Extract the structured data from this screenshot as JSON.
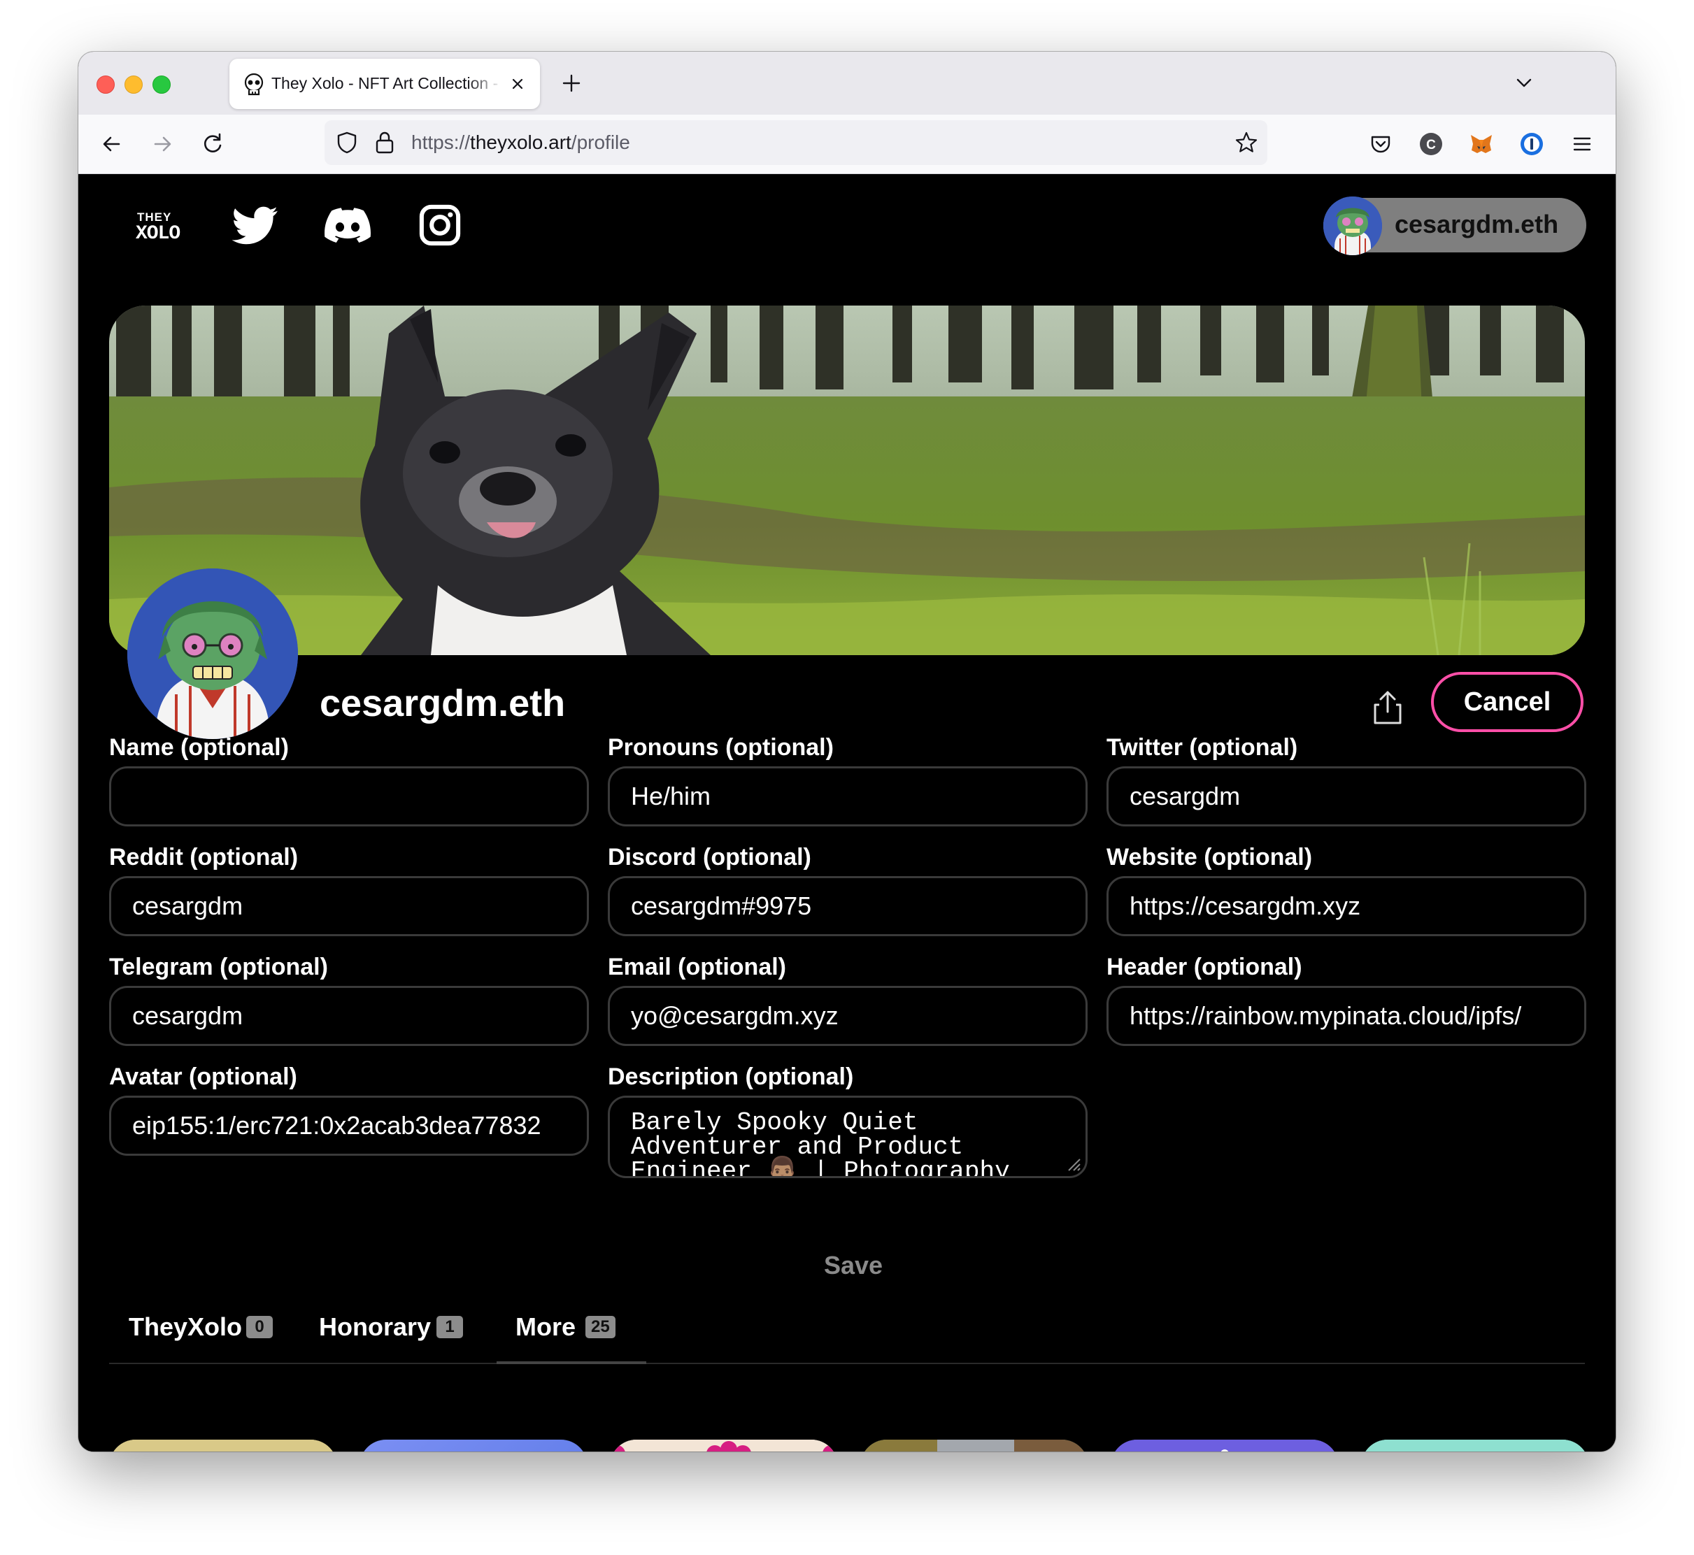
{
  "browser": {
    "tab_title": "They Xolo - NFT Art Collection - ",
    "url_scheme": "https://",
    "url_host": "theyxolo.art",
    "url_path": "/profile"
  },
  "site": {
    "logo_top": "THEY",
    "logo_bottom": "XOLO",
    "account_name": "cesargdm.eth"
  },
  "profile": {
    "display_name": "cesargdm.eth",
    "cancel_label": "Cancel",
    "save_label": "Save"
  },
  "fields": [
    {
      "label": "Name (optional)",
      "value": ""
    },
    {
      "label": "Pronouns (optional)",
      "value": "He/him"
    },
    {
      "label": "Twitter (optional)",
      "value": "cesargdm"
    },
    {
      "label": "Reddit (optional)",
      "value": "cesargdm"
    },
    {
      "label": "Discord (optional)",
      "value": "cesargdm#9975"
    },
    {
      "label": "Website (optional)",
      "value": "https://cesargdm.xyz"
    },
    {
      "label": "Telegram (optional)",
      "value": "cesargdm"
    },
    {
      "label": "Email (optional)",
      "value": "yo@cesargdm.xyz"
    },
    {
      "label": "Header (optional)",
      "value": "https://rainbow.mypinata.cloud/ipfs/"
    },
    {
      "label": "Avatar (optional)",
      "value": "eip155:1/erc721:0x2acab3dea77832"
    },
    {
      "label": "Description (optional)",
      "value": "Barely Spooky Quiet\nAdventurer and Product\nEngineer 👨🏽 | Photography"
    }
  ],
  "collection_tabs": [
    {
      "label": "TheyXolo",
      "count": "0"
    },
    {
      "label": "Honorary",
      "count": "1"
    },
    {
      "label": "More",
      "count": "25"
    }
  ],
  "colors": {
    "accent": "#ff4fa8",
    "page_bg": "#000000",
    "input_border": "#3a3a3a"
  },
  "icons": [
    "skull-favicon",
    "close-icon",
    "plus-icon",
    "chevron-down-icon",
    "back-icon",
    "forward-icon",
    "reload-icon",
    "shield-icon",
    "lock-icon",
    "star-icon",
    "pocket-icon",
    "c-extension-icon",
    "metamask-icon",
    "onepassword-icon",
    "menu-icon",
    "twitter-icon",
    "discord-icon",
    "instagram-icon",
    "share-icon"
  ]
}
